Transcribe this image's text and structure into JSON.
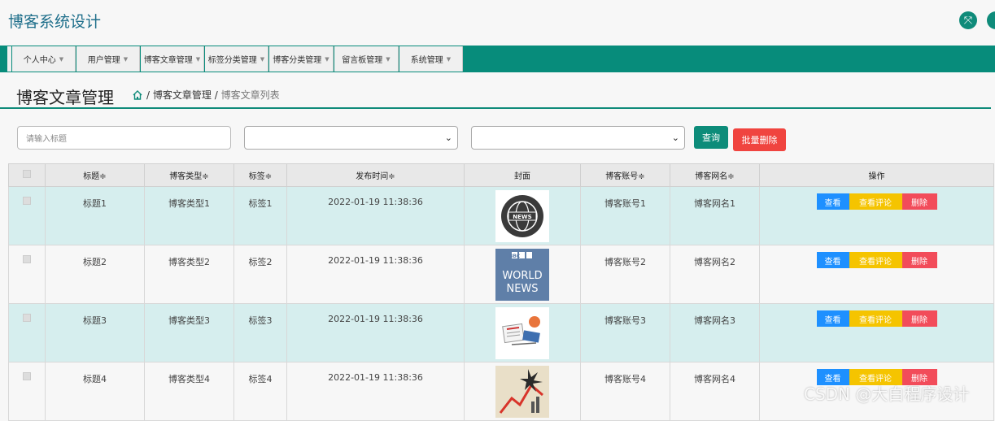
{
  "header": {
    "app_title": "博客系统设计"
  },
  "nav": {
    "items": [
      "个人中心",
      "用户管理",
      "博客文章管理",
      "标签分类管理",
      "博客分类管理",
      "留言板管理",
      "系统管理"
    ]
  },
  "page": {
    "title": "博客文章管理",
    "breadcrumb": {
      "sep1": "/",
      "section": "博客文章管理",
      "sep2": "/",
      "current": "博客文章列表"
    }
  },
  "filters": {
    "search_placeholder": "请输入标题",
    "query_label": "查询",
    "batch_delete_label": "批量删除"
  },
  "table": {
    "headers": [
      "标题",
      "博客类型",
      "标签",
      "发布时间",
      "封面",
      "博客账号",
      "博客网名",
      "操作"
    ],
    "sort_mark": "≑",
    "rows": [
      {
        "title": "标题1",
        "type": "博客类型1",
        "tag": "标签1",
        "time": "2022-01-19 11:38:36",
        "cover": "news-globe-icon",
        "account": "博客账号1",
        "nickname": "博客网名1"
      },
      {
        "title": "标题2",
        "type": "博客类型2",
        "tag": "标签2",
        "time": "2022-01-19 11:38:36",
        "cover": "bbc-world-news",
        "cover_text": [
          "BBC",
          "WORLD",
          "NEWS"
        ],
        "account": "博客账号2",
        "nickname": "博客网名2"
      },
      {
        "title": "标题3",
        "type": "博客类型3",
        "tag": "标签3",
        "time": "2022-01-19 11:38:36",
        "cover": "newspaper-illustration",
        "account": "博客账号3",
        "nickname": "博客网名3"
      },
      {
        "title": "标题4",
        "type": "博客类型4",
        "tag": "标签4",
        "time": "2022-01-19 11:38:36",
        "cover": "chart-illustration",
        "account": "博客账号4",
        "nickname": "博客网名4"
      }
    ],
    "actions": {
      "view": "查看",
      "comments": "查看评论",
      "delete": "删除"
    }
  },
  "watermark": "CSDN @大白程序设计",
  "colors": {
    "primary": "#078c7b",
    "title_blue": "#1f6f8b",
    "danger": "#f0443f",
    "view_blue": "#1e90ff",
    "comment_yellow": "#f5c400",
    "row_highlight": "#d6eeee"
  }
}
